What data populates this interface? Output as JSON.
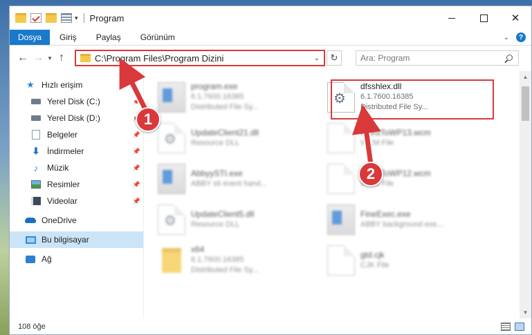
{
  "titlebar": {
    "title": "Program",
    "close_glyph": "✕",
    "icons": [
      "folder-icon",
      "checkmark-icon",
      "properties-icon"
    ]
  },
  "ribbon": {
    "tabs": [
      "Dosya",
      "Giriş",
      "Paylaş",
      "Görünüm"
    ],
    "help": "?"
  },
  "navigation": {
    "back": "←",
    "forward": "→",
    "recent": "▾",
    "up": "↑",
    "address": "C:\\Program Files\\Program Dizini",
    "refresh": "↻",
    "search_placeholder": "Ara: Program"
  },
  "sidebar": {
    "items": [
      {
        "label": "Hızlı erişim",
        "icon": "star-icon"
      },
      {
        "label": "Yerel Disk (C:)",
        "icon": "disk-icon"
      },
      {
        "label": "Yerel Disk (D:)",
        "icon": "disk-icon"
      },
      {
        "label": "Belgeler",
        "icon": "documents-icon"
      },
      {
        "label": "İndirmeler",
        "icon": "download-icon"
      },
      {
        "label": "Müzik",
        "icon": "music-icon"
      },
      {
        "label": "Resimler",
        "icon": "pictures-icon"
      },
      {
        "label": "Videolar",
        "icon": "video-icon"
      },
      {
        "label": "OneDrive",
        "icon": "cloud-icon"
      },
      {
        "label": "Bu bilgisayar",
        "icon": "computer-icon"
      },
      {
        "label": "Ağ",
        "icon": "network-icon"
      }
    ]
  },
  "files": [
    {
      "name": "program.exe",
      "line1": "6.1.7600.16385",
      "line2": "Distributed File Sy...",
      "icon": "exe-icon"
    },
    {
      "name": "dfsshlex.dll",
      "line1": "6.1.7600.16385",
      "line2": "Distributed File Sy...",
      "icon": "dll-gear-icon"
    },
    {
      "name": "UpdateClient21.dll",
      "line1": "Resource DLL",
      "line2": "",
      "icon": "dll-gear-icon"
    },
    {
      "name": "WordToWP13.wcm",
      "line1": "WCM File",
      "line2": "",
      "icon": "document-icon"
    },
    {
      "name": "AbbyySTI.exe",
      "line1": "ABBY sti event hand...",
      "line2": "",
      "icon": "exe-icon"
    },
    {
      "name": "WordToWP12.wcm",
      "line1": "WCM File",
      "line2": "",
      "icon": "document-icon"
    },
    {
      "name": "UpdateClient5.dll",
      "line1": "Resource DLL",
      "line2": "",
      "icon": "dll-gear-icon"
    },
    {
      "name": "FineExec.exe",
      "line1": "ABBY background exe...",
      "line2": "",
      "icon": "exe-icon"
    },
    {
      "name": "x64",
      "line1": "6.1.7600.16385",
      "line2": "Distributed File Sy...",
      "icon": "folder-icon"
    },
    {
      "name": "gtd.cjk",
      "line1": "CJK File",
      "line2": "",
      "icon": "document-icon"
    }
  ],
  "status": {
    "count": "108 öğe"
  },
  "callouts": {
    "one": "1",
    "two": "2"
  },
  "colors": {
    "accent": "#1979ca",
    "highlight": "#d9393b",
    "selected": "#cce4f7"
  }
}
